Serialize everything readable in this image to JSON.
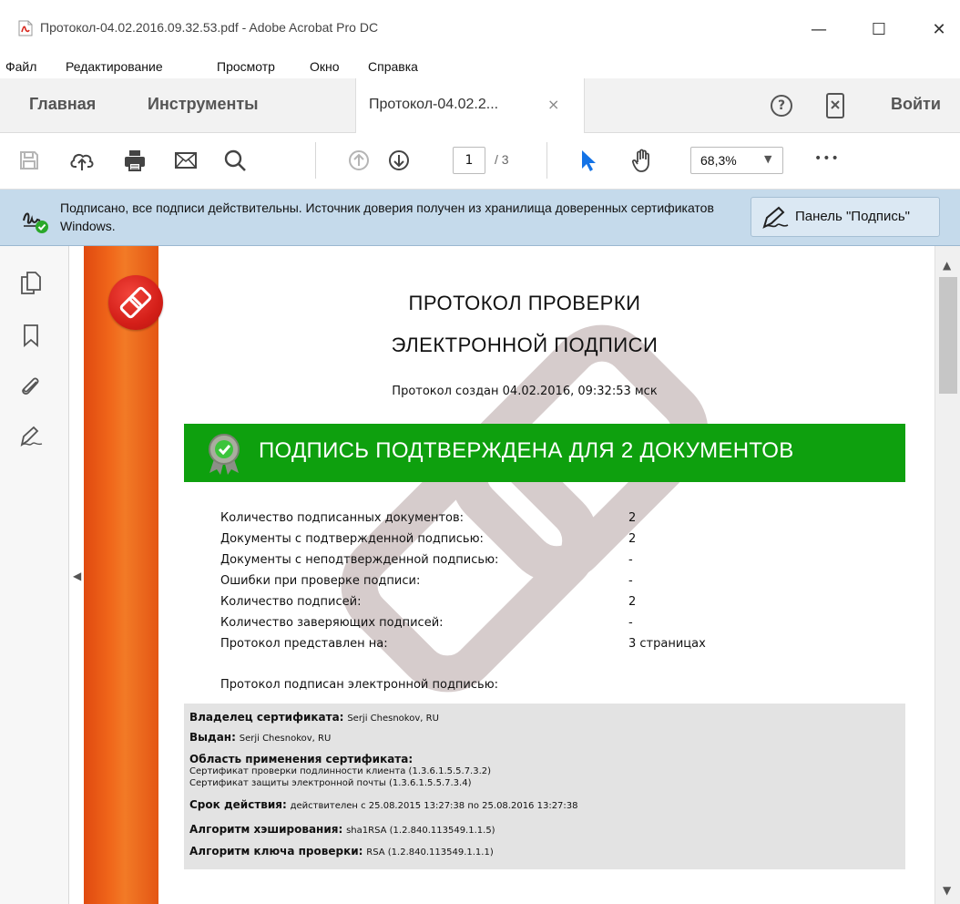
{
  "window": {
    "title": "Протокол-04.02.2016.09.32.53.pdf - Adobe Acrobat Pro DC",
    "minimize": "—",
    "maximize": "☐",
    "close": "✕"
  },
  "menu": {
    "items": [
      "Файл",
      "Редактирование",
      "Просмотр",
      "Окно",
      "Справка"
    ]
  },
  "tabs": {
    "home": "Главная",
    "tools": "Инструменты",
    "document": "Протокол-04.02.2...",
    "document_close": "×",
    "help_icon": "?",
    "signin": "Войти"
  },
  "toolbar": {
    "page_current": "1",
    "page_total": "/ 3",
    "zoom": "68,3%",
    "more": "•••"
  },
  "signature_bar": {
    "message": "Подписано, все подписи действительны. Источник доверия получен из хранилища доверенных сертификатов Windows.",
    "panel_button": "Панель \"Подпись\""
  },
  "document": {
    "title_line1": "ПРОТОКОЛ ПРОВЕРКИ",
    "title_line2": "ЭЛЕКТРОННОЙ ПОДПИСИ",
    "created": "Протокол создан  04.02.2016, 09:32:53 мск",
    "banner": "ПОДПИСЬ ПОДТВЕРЖДЕНА ДЛЯ 2 ДОКУМЕНТОВ",
    "stats": [
      {
        "label": "Количество подписанных документов:",
        "value": "2"
      },
      {
        "label": "Документы с подтвержденной подписью:",
        "value": "2"
      },
      {
        "label": "Документы с неподтвержденной подписью:",
        "value": "-"
      },
      {
        "label": "Ошибки при проверке подписи:",
        "value": "-"
      },
      {
        "label": "Количество подписей:",
        "value": "2"
      },
      {
        "label": "Количество заверяющих подписей:",
        "value": "-"
      },
      {
        "label": "Протокол представлен на:",
        "value": "3 страницах"
      }
    ],
    "signed_by": "Протокол подписан электронной подписью:",
    "certificate": {
      "owner_label": "Владелец сертификата:",
      "owner_value": "Serji Chesnokov, RU",
      "issued_label": "Выдан:",
      "issued_value": "Serji Chesnokov, RU",
      "scope_label": "Область применения сертификата:",
      "scope_line1": "Сертификат проверки подлинности клиента (1.3.6.1.5.5.7.3.2)",
      "scope_line2": "Сертификат защиты электронной почты (1.3.6.1.5.5.7.3.4)",
      "validity_label": "Срок действия:",
      "validity_value": "действителен с 25.08.2015 13:27:38 по 25.08.2016 13:27:38",
      "hash_label": "Алгоритм хэширования:",
      "hash_value": "sha1RSA (1.2.840.113549.1.1.5)",
      "key_label": "Алгоритм ключа проверки:",
      "key_value": "RSA (1.2.840.113549.1.1.1)"
    }
  },
  "colors": {
    "signature_bar": "#c5daeb",
    "banner_green": "#0ea00e",
    "orange_strip": "#f0661a",
    "cert_box": "#e3e3e3"
  }
}
